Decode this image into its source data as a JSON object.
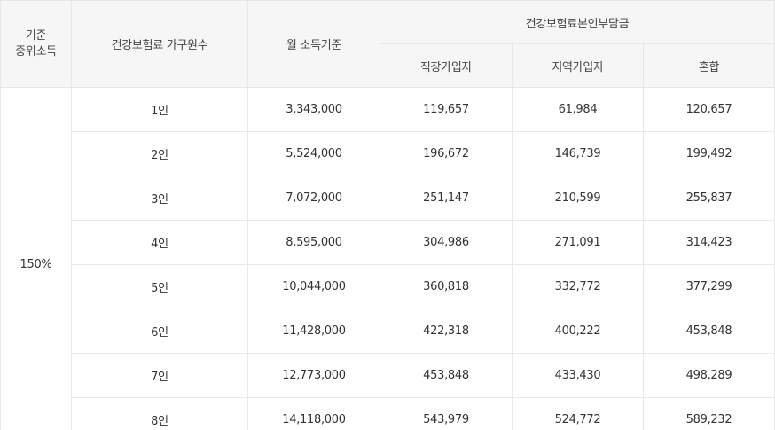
{
  "header": {
    "basis_line1": "기준",
    "basis_line2": "중위소득",
    "household": "건강보험료 가구원수",
    "monthly_income": "월 소득기준",
    "contribution_group": "건강보험료본인부담금",
    "workplace": "직장가입자",
    "regional": "지역가입자",
    "mixed": "혼합"
  },
  "basis_value": "150%",
  "rows": [
    {
      "household": "1인",
      "income": "3,343,000",
      "workplace": "119,657",
      "regional": "61,984",
      "mixed": "120,657"
    },
    {
      "household": "2인",
      "income": "5,524,000",
      "workplace": "196,672",
      "regional": "146,739",
      "mixed": "199,492"
    },
    {
      "household": "3인",
      "income": "7,072,000",
      "workplace": "251,147",
      "regional": "210,599",
      "mixed": "255,837"
    },
    {
      "household": "4인",
      "income": "8,595,000",
      "workplace": "304,986",
      "regional": "271,091",
      "mixed": "314,423"
    },
    {
      "household": "5인",
      "income": "10,044,000",
      "workplace": "360,818",
      "regional": "332,772",
      "mixed": "377,299"
    },
    {
      "household": "6인",
      "income": "11,428,000",
      "workplace": "422,318",
      "regional": "400,222",
      "mixed": "453,848"
    },
    {
      "household": "7인",
      "income": "12,773,000",
      "workplace": "453,848",
      "regional": "433,430",
      "mixed": "498,289"
    },
    {
      "household": "8인",
      "income": "14,118,000",
      "workplace": "543,979",
      "regional": "524,772",
      "mixed": "589,232"
    }
  ]
}
